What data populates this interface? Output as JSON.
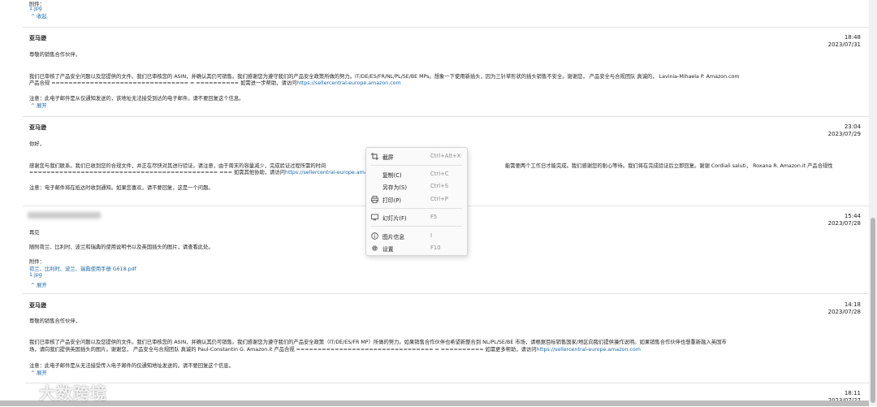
{
  "top_fragment": {
    "attachment_label": "附件：",
    "file": "1.jpg",
    "collapse": "收起"
  },
  "messages": [
    {
      "sender": "亚马逊",
      "time": "18:48",
      "date": "2023/07/31",
      "greeting": "尊敬的销售合作伙伴，",
      "body1": "我们已审核了产品安全问题以及您提供的文件。我们已审核您的 ASIN，并确认其仍可销售。我们感谢您为遵守我们的产品安全政策所做的努力。IT/DE/ES/FR/NL/PL/SE/BE MPs。想象一下使用新插头，因为三针草形状的插头销售不安全。谢谢您，  产品安全与合规团队 真诚的， Lavinia-Mihaela P. Amazon.com",
      "body2": "产品合规 ================================ = ========== 如需进一步帮助，请访问",
      "link": "https://sellercentral-europe.amazon.com",
      "note": "注意：此电子邮件是从仅通知发送的，该地址无法接受到达的电子邮件。请不要回复这个信息。",
      "toggle": "展开"
    },
    {
      "sender": "亚马逊",
      "time": "23:04",
      "date": "2023/07/29",
      "greeting": "你好，",
      "body1": "感谢您与我们联系。我们已收到您的合规文件，并正在尽快对其进行验证。请注意，由于周末的容量减少，完成验证过程所需的时间",
      "body1b": "能需要两个工作日才能完成。我们感谢您的耐心等待。我们将在完成验证后立即回复。谢谢 Cordiali saluti， Roxana R. Amazon.it 产品合规性",
      "body2": "============================================ === 如需其他协助，请访问",
      "link": "https://sellercentral-europe.amazon.com",
      "note": "注意：电子邮件将在抵达时收到通知。如果您喜欢，请不要回复，这是一个问题。"
    },
    {
      "time": "15:44",
      "date": "2023/07/28",
      "greeting": "再见",
      "body1": "随附荷兰、比利时、波兰和瑞典的使用说明书以及英国插头的图片，请查看此处。",
      "attachment_label": "附件：",
      "file1": "荷兰、比利时、波兰、瑞典使用手册 G618.pdf",
      "file2": "1.jpg",
      "toggle": "展开"
    },
    {
      "sender": "亚马逊",
      "time": "14:18",
      "date": "2023/07/28",
      "greeting": "尊敬的销售合作伙伴，",
      "body1": "我们已审核了产品安全问题以及您提供的文件。我们已审核您的 ASIN，并确认其仍可销售。我们感谢您为遵守我们的产品安全政策（IT/DE/ES/FR MP）所做的努力。如果销售合作伙伴也希望新整合到 NL/PL/SE/BE 市场，请根据目标销售国家/地区向我们提供操作说明。如果销售合作伙伴也想重新融入英国市",
      "body2": "场，请向我们提供英国插头的图片。谢谢您，  产品安全与合规团队 真诚的 Paul-Constantin G. Amazon.it 产品合规 ================================ = ========== 如需更多帮助，请访问",
      "link": "https://sellercentral-europe.amazon.com",
      "note": "注意：此电子邮件是从无法接受传入电子邮件的仅通知地址发送的。请不要回复这个信息。",
      "toggle": "展开"
    },
    {
      "time": "18:11",
      "date": "2023/07/27"
    }
  ],
  "context_menu": {
    "items": [
      {
        "icon": "crop-icon",
        "label": "截屏",
        "shortcut": "Ctrl+Alt+X"
      },
      {
        "icon": "",
        "label": "复制(C)",
        "shortcut": "Ctrl+C"
      },
      {
        "icon": "",
        "label": "另存为(S)",
        "shortcut": "Ctrl+S"
      },
      {
        "icon": "printer-icon",
        "label": "打印(P)",
        "shortcut": "Ctrl+P"
      },
      {
        "icon": "slideshow-icon",
        "label": "幻灯片(F)",
        "shortcut": "F5"
      },
      {
        "icon": "info-icon",
        "label": "图片信息",
        "shortcut": "I"
      },
      {
        "icon": "gear-icon",
        "label": "设置",
        "shortcut": "F10"
      }
    ]
  },
  "watermark": {
    "text": "大数跨境"
  }
}
